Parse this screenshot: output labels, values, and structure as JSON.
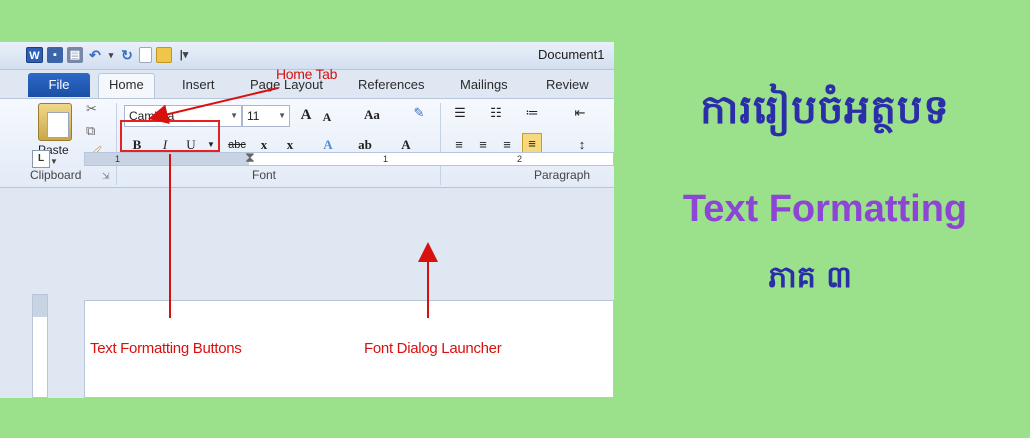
{
  "colors": {
    "background": "#9be08a",
    "annotation": "#d8110f",
    "khmer_title": "#2a2ea8",
    "english_title": "#8c45d4",
    "file_tab": "#1b4fa5"
  },
  "window": {
    "document_title": "Document1",
    "quick_access_icons": [
      "word-icon",
      "save-icon",
      "print-preview-icon",
      "undo-icon",
      "redo-icon",
      "new-document-icon",
      "open-folder-icon",
      "customize-icon"
    ]
  },
  "tabs": {
    "file": "File",
    "items": [
      "Home",
      "Insert",
      "Page Layout",
      "References",
      "Mailings",
      "Review"
    ]
  },
  "ribbon": {
    "clipboard": {
      "paste": "Paste",
      "label": "Clipboard"
    },
    "font": {
      "font_name": "Cambria",
      "font_size": "11",
      "grow": "A",
      "shrink": "A",
      "change_case": "Aa",
      "bold": "B",
      "italic": "I",
      "underline": "U",
      "strikethrough": "abc",
      "subscript": "x",
      "superscript": "x",
      "text_effects": "A",
      "highlight": "ab",
      "font_color": "A",
      "label": "Font"
    },
    "paragraph": {
      "label": "Paragraph"
    }
  },
  "ruler": {
    "ticks": [
      "1",
      "1",
      "2"
    ],
    "corner": "L"
  },
  "annotations": {
    "home_tab": "Home Tab",
    "text_formatting_buttons": "Text Formatting Buttons",
    "font_dialog_launcher": "Font Dialog Launcher"
  },
  "titles": {
    "khmer_main": "ការរៀបចំអត្ថបទ",
    "english": "Text Formatting",
    "khmer_part": "ភាគ ៣"
  }
}
